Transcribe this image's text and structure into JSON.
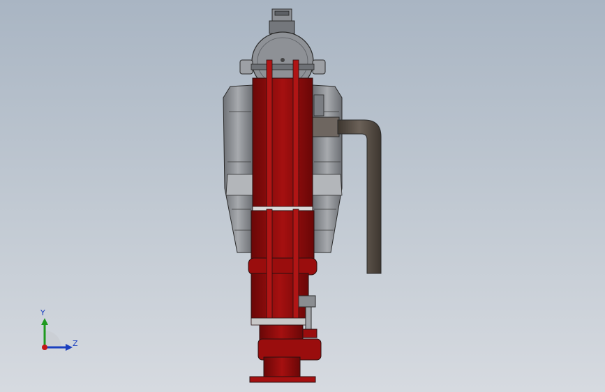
{
  "viewport": {
    "background_top": "#a9b5c3",
    "background_bottom": "#d6dae0"
  },
  "model": {
    "body_color": "#8b0a0a",
    "housing_color": "#8f9297",
    "pipe_color": "#5a5148"
  },
  "triad": {
    "y_label": "Y",
    "z_label": "Z",
    "y_color": "#1f9a1f",
    "z_color": "#1a3fbf",
    "x_color": "#c31616"
  }
}
